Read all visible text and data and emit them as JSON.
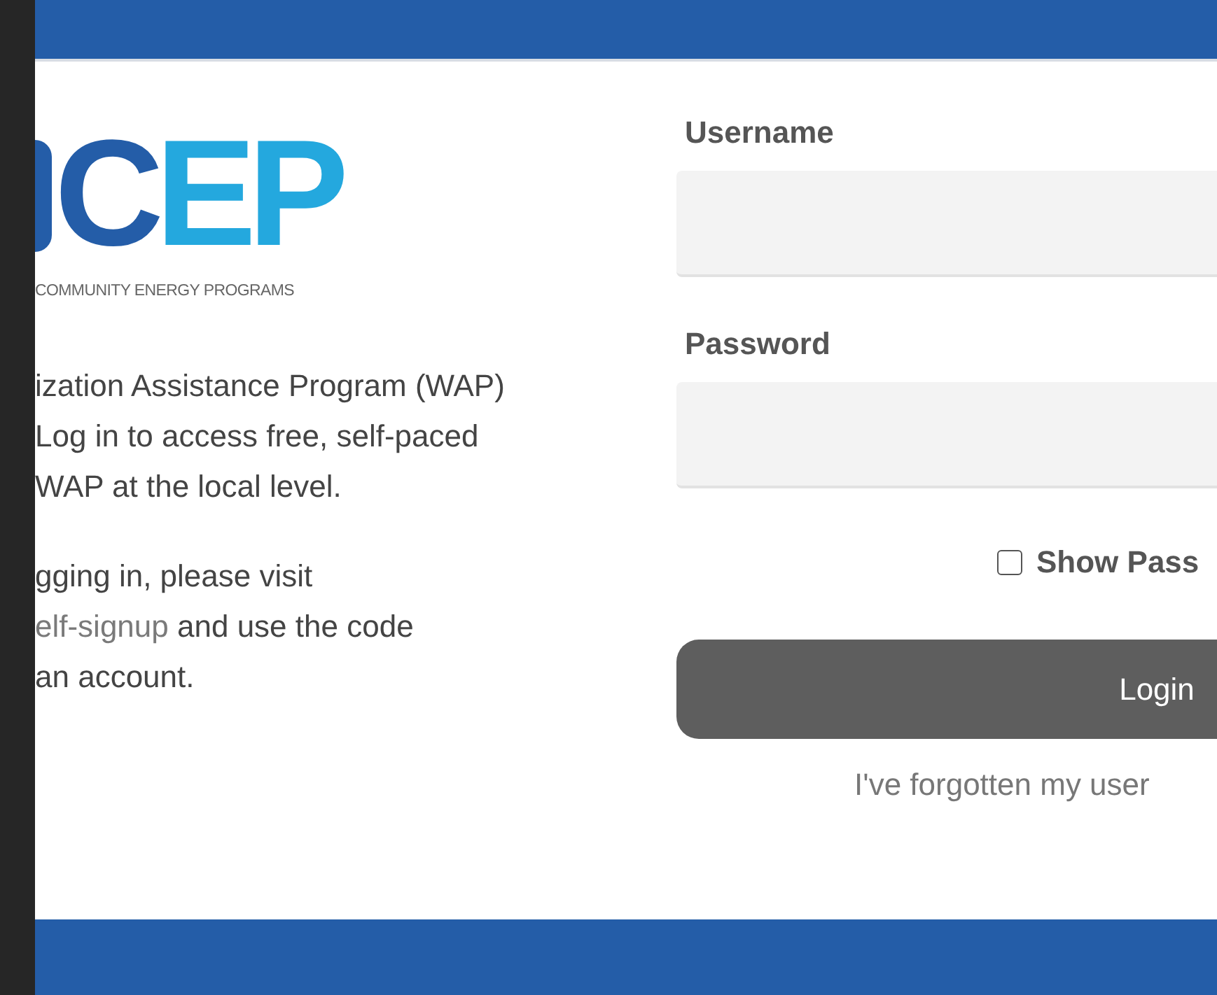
{
  "logo": {
    "letters": [
      {
        "text": "C",
        "kind": "dark"
      },
      {
        "text": "EP",
        "kind": "light"
      }
    ],
    "tagline": "COMMUNITY ENERGY PROGRAMS"
  },
  "intro": {
    "paragraphs": [
      {
        "lines": [
          [
            {
              "text": "ization Assistance Program (WAP)",
              "link": false
            }
          ],
          [
            {
              "text": "Log in to access free, self-paced",
              "link": false
            }
          ],
          [
            {
              "text": "WAP at the local level.",
              "link": false
            }
          ]
        ]
      },
      {
        "lines": [
          [
            {
              "text": "gging in, please visit",
              "link": false
            }
          ],
          [
            {
              "text": "elf-signup",
              "link": true
            },
            {
              "text": " and use the code",
              "link": false
            }
          ],
          [
            {
              "text": "an account.",
              "link": false
            }
          ]
        ]
      }
    ]
  },
  "form": {
    "username_label": "Username",
    "password_label": "Password",
    "show_password": {
      "label": "Show Pass",
      "checked": false
    },
    "login_button": "Login",
    "forgot_link": "I've forgotten my user"
  }
}
